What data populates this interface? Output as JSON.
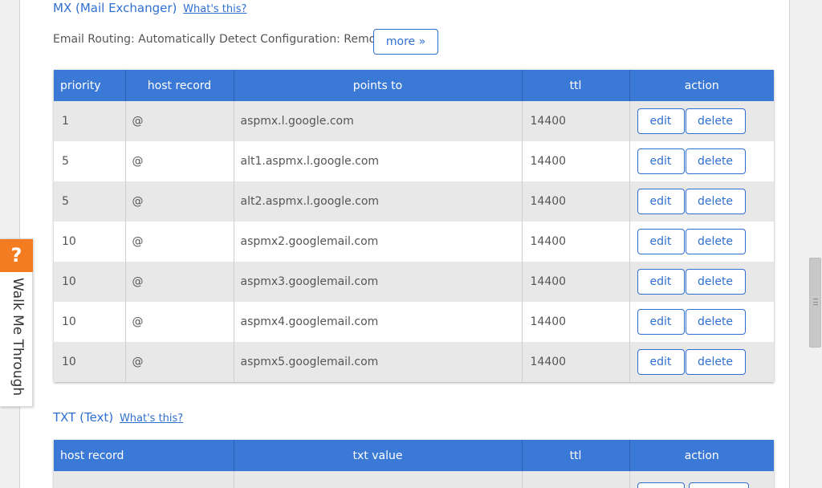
{
  "mx": {
    "title": "MX (Mail Exchanger)",
    "whats_this": "What's this?",
    "routing": "Email Routing: Automatically Detect Configuration: Remote",
    "more_label": "more »",
    "headers": [
      "priority",
      "host record",
      "points to",
      "ttl",
      "action"
    ],
    "rows": [
      {
        "priority": "1",
        "host": "@",
        "points_to": "aspmx.l.google.com",
        "ttl": "14400"
      },
      {
        "priority": "5",
        "host": "@",
        "points_to": "alt1.aspmx.l.google.com",
        "ttl": "14400"
      },
      {
        "priority": "5",
        "host": "@",
        "points_to": "alt2.aspmx.l.google.com",
        "ttl": "14400"
      },
      {
        "priority": "10",
        "host": "@",
        "points_to": "aspmx2.googlemail.com",
        "ttl": "14400"
      },
      {
        "priority": "10",
        "host": "@",
        "points_to": "aspmx3.googlemail.com",
        "ttl": "14400"
      },
      {
        "priority": "10",
        "host": "@",
        "points_to": "aspmx4.googlemail.com",
        "ttl": "14400"
      },
      {
        "priority": "10",
        "host": "@",
        "points_to": "aspmx5.googlemail.com",
        "ttl": "14400"
      }
    ],
    "edit_label": "edit",
    "delete_label": "delete"
  },
  "txt": {
    "title": "TXT (Text)",
    "whats_this": "What's this?",
    "headers": [
      "host record",
      "txt value",
      "ttl",
      "action"
    ],
    "edit_label": "edit",
    "delete_label": "delete"
  },
  "walk_me": {
    "icon": "question-icon",
    "glyph": "?",
    "label": "Walk Me Through"
  },
  "colors": {
    "accent": "#3a79d6",
    "link": "#2f6fd0",
    "walk_badge": "#f47c20"
  }
}
